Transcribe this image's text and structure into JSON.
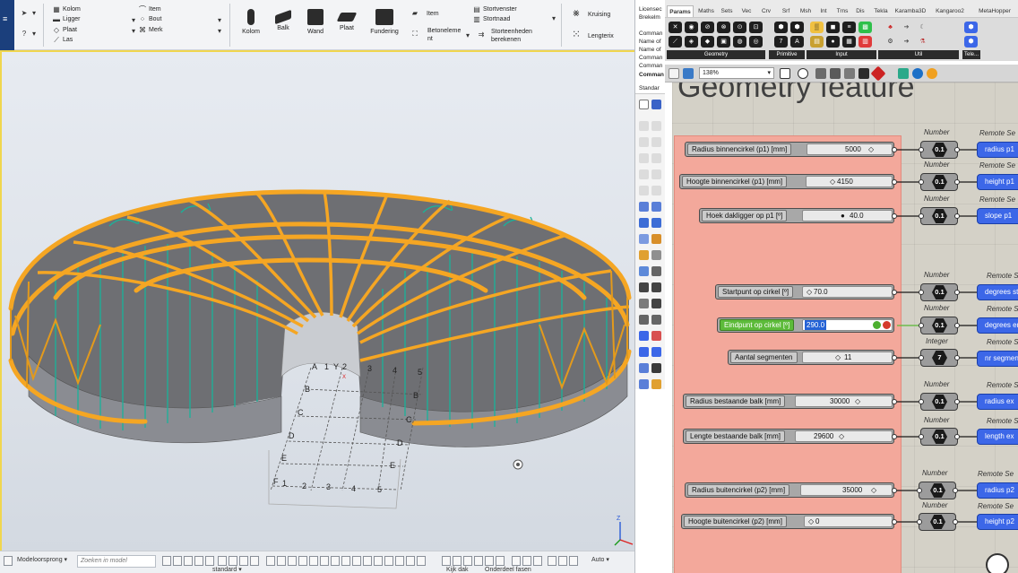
{
  "tekla": {
    "ribbon": {
      "small_items_col1": [
        "Kolom",
        "Ligger",
        "Plaat",
        "Las"
      ],
      "small_items_col2": [
        "Item",
        "Bout",
        "Merk"
      ],
      "big_buttons": [
        "Kolom",
        "Balk",
        "Wand",
        "Plaat",
        "Fundering"
      ],
      "item_label": "Item",
      "beton_label_1": "Betoneleme",
      "beton_label_2": "nt",
      "stort_items": [
        "Stortvenster",
        "Stortnaad"
      ],
      "storteenheden_1": "Storteenheden",
      "storteenheden_2": "berekenen",
      "kruising": "Kruising",
      "lengterix": "Lengterix"
    },
    "viewport": {
      "grid_labels_top": [
        "A",
        "1",
        "Y",
        "2",
        "3",
        "4",
        "5"
      ],
      "grid_labels_bottom": [
        "1",
        "2",
        "3",
        "4",
        "5"
      ],
      "grid_labels_left": [
        "B",
        "C",
        "D",
        "E",
        "F"
      ],
      "grid_labels_right": [
        "B",
        "C",
        "D",
        "E"
      ],
      "axis_z": "Z",
      "axis_x": "X"
    },
    "status": {
      "origin_select": "Modeloorsprong",
      "search_placeholder": "Zoeken in model",
      "standard_select": "standard",
      "auto_select": "Auto",
      "bottom_text_1": "Kijk dak",
      "bottom_text_2": "Onderdeel fasen"
    }
  },
  "rhino": {
    "command_lines": [
      "Licensec",
      "Brekelm",
      "",
      "Comman",
      "Name of",
      "Name of",
      "Comman",
      "Comman",
      "Comman"
    ],
    "standard_tab": "Standar"
  },
  "grasshopper": {
    "tabs": [
      "Params",
      "Maths",
      "Sets",
      "Vec",
      "Crv",
      "Srf",
      "Msh",
      "Int",
      "Trns",
      "Dis",
      "Tekla",
      "Karamba3D",
      "Kangaroo2",
      "MetaHopper"
    ],
    "active_tab": "Params",
    "palette_groups": [
      "Geometry",
      "Primitive",
      "Input",
      "Util",
      "Tele..."
    ],
    "zoom": "138%",
    "group_title": "Geometry feature",
    "sliders": [
      {
        "label": "Radius binnencirkel (p1) [mm]",
        "value": "5000",
        "num_label": "Number",
        "num_value": "0.1",
        "remote_label": "Remote Se",
        "remote": "radius p1"
      },
      {
        "label": "Hoogte binnencirkel (p1)  [mm]",
        "value": "4150",
        "num_label": "Number",
        "num_value": "0.1",
        "remote_label": "Remote Se",
        "remote": "height p1"
      },
      {
        "label": "Hoek dakligger op p1 [º]",
        "value": "40.0",
        "num_label": "Number",
        "num_value": "0.1",
        "remote_label": "Remote Se",
        "remote": "slope p1"
      },
      {
        "label": "Startpunt op cirkel [º]",
        "value": "70.0",
        "num_label": "Number",
        "num_value": "0.1",
        "remote_label": "Remote Se",
        "remote": "degrees st"
      },
      {
        "label": "Eindpunt op cirkel [º]",
        "value": "290.0",
        "num_label": "Number",
        "num_value": "0.1",
        "remote_label": "Remote Se",
        "remote": "degrees en"
      },
      {
        "label": "Aantal segmenten",
        "value": "11",
        "num_label": "Integer",
        "num_value": "7",
        "remote_label": "Remote Se",
        "remote": "nr segmen"
      },
      {
        "label": "Radius bestaande balk [mm]",
        "value": "30000",
        "num_label": "Number",
        "num_value": "0.1",
        "remote_label": "Remote Se",
        "remote": "radius ex"
      },
      {
        "label": "Lengte bestaande balk [mm]",
        "value": "29600",
        "num_label": "Number",
        "num_value": "0.1",
        "remote_label": "Remote Se",
        "remote": "length ex"
      },
      {
        "label": "Radius buitencirkel (p2) [mm]",
        "value": "35000",
        "num_label": "Number",
        "num_value": "0.1",
        "remote_label": "Remote Se",
        "remote": "radius p2"
      },
      {
        "label": "Hoogte buitencirkel (p2) [mm]",
        "value": "0",
        "num_label": "Number",
        "num_value": "0.1",
        "remote_label": "Remote Se",
        "remote": "height p2"
      }
    ]
  },
  "colors": {
    "tekla_blue": "#1b3f7c",
    "steel_orange": "#f5a623",
    "group_salmon": "#f3a89b",
    "remote_blue": "#3c67e8",
    "slider_edit_green": "#5dbb3a"
  }
}
